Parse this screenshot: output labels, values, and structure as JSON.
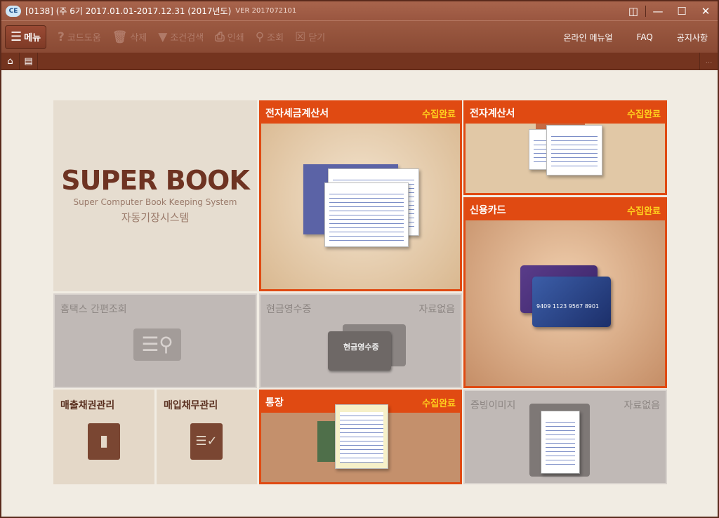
{
  "window": {
    "logo": "CE",
    "title": "[0138] (주     6기  2017.01.01-2017.12.31  (2017년도)",
    "version": "VER 2017072101",
    "controls": [
      "book-icon",
      "minimize-icon",
      "maximize-icon",
      "close-icon"
    ]
  },
  "toolbar": {
    "menu": "메뉴",
    "items": [
      {
        "icon": "question-icon",
        "label": "코드도움"
      },
      {
        "icon": "trash-icon",
        "label": "삭제"
      },
      {
        "icon": "filter-icon",
        "label": "조건검색"
      },
      {
        "icon": "printer-icon",
        "label": "인쇄"
      },
      {
        "icon": "search-doc-icon",
        "label": "조회"
      },
      {
        "icon": "close-box-icon",
        "label": "닫기"
      }
    ],
    "links": [
      "온라인 메뉴얼",
      "FAQ",
      "공지사항"
    ]
  },
  "tabs": {
    "home": "home-icon",
    "apps": "apps-icon",
    "more": "..."
  },
  "brand": {
    "title": "SUPER BOOK",
    "subtitle": "Super Computer Book Keeping System",
    "korean": "자동기장시스템"
  },
  "tiles": {
    "etax": {
      "title": "전자세금계산서",
      "status": "수집완료"
    },
    "einvoice": {
      "title": "전자계산서",
      "status": "수집완료"
    },
    "card": {
      "title": "신용카드",
      "status": "수집완료",
      "card_text": "9409 1123 9567 8901"
    },
    "hometax": {
      "title": "홈택스 간편조회"
    },
    "cash": {
      "title": "현금영수증",
      "status": "자료없음",
      "card_text": "현금영수증"
    },
    "sales": {
      "title": "매출채권관리"
    },
    "purchase": {
      "title": "매입채무관리"
    },
    "bank": {
      "title": "통장",
      "status": "수집완료"
    },
    "evidence": {
      "title": "증빙이미지",
      "status": "자료없음"
    }
  },
  "colors": {
    "accent": "#e04a12",
    "status": "#ffd21e",
    "brand": "#6e3322"
  }
}
